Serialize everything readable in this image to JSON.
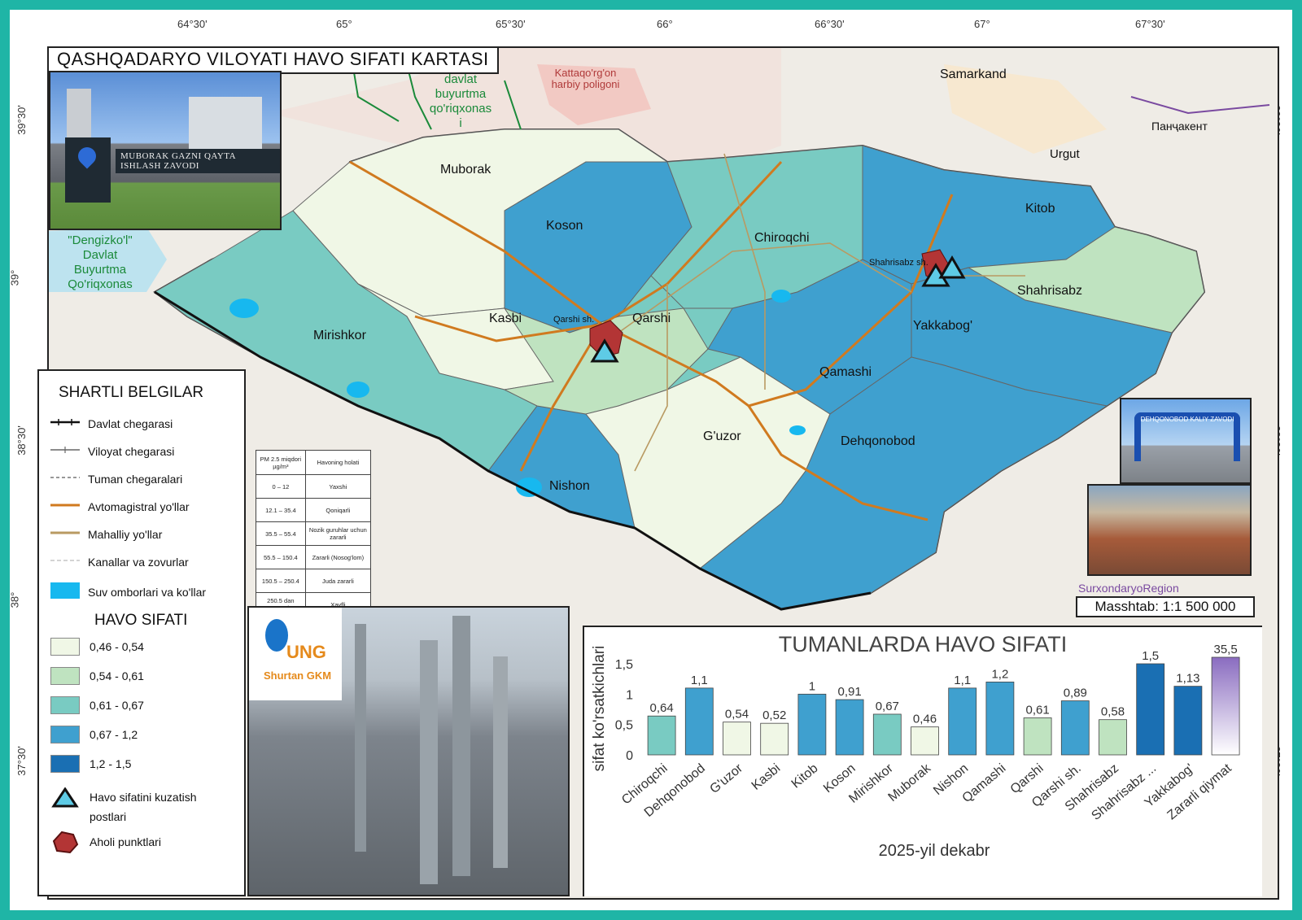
{
  "title": "QASHQADARYO VILOYATI HAVO SIFATI KARTASI",
  "coords": {
    "top_bottom": [
      "64°30'",
      "65°",
      "65°30'",
      "66°",
      "66°30'",
      "67°",
      "67°30'"
    ],
    "sides": [
      "39°30'",
      "39°",
      "38°30'",
      "38°",
      "37°30'"
    ]
  },
  "districts": [
    {
      "name": "Muborak",
      "value_class": "0,46 - 0,54"
    },
    {
      "name": "Koson",
      "value_class": "0,67 - 1,2"
    },
    {
      "name": "Chiroqchi",
      "value_class": "0,61 - 0,67"
    },
    {
      "name": "Kitob",
      "value_class": "0,67 - 1,2"
    },
    {
      "name": "Shahrisabz",
      "value_class": "0,54 - 0,61"
    },
    {
      "name": "Mirishkor",
      "value_class": "0,61 - 0,67"
    },
    {
      "name": "Kasbi",
      "value_class": "0,46 - 0,54"
    },
    {
      "name": "Qarshi",
      "value_class": "0,54 - 0,61"
    },
    {
      "name": "Yakkabog'",
      "value_class": "0,67 - 1,2"
    },
    {
      "name": "Qamashi",
      "value_class": "0,67 - 1,2"
    },
    {
      "name": "G'uzor",
      "value_class": "0,46 - 0,54"
    },
    {
      "name": "Dehqonobod",
      "value_class": "0,67 - 1,2"
    },
    {
      "name": "Nishon",
      "value_class": "0,67 - 1,2"
    }
  ],
  "places": {
    "qarshi_sh": "Qarshi sh.",
    "shahrisabz_sh": "Shahrisabz sh.",
    "samarkand": "Samarkand",
    "urgut": "Urgut",
    "panjakent": "Панҷакент",
    "kattaqorgon": "Kattaqo'rg'on harbiy poligoni",
    "davlat_buyurtma": "davlat buyurtma qo'riqxonas i",
    "dengizkol": "\"Dengizko'l\" Davlat Buyurtma Qo'riqxonas",
    "surxondaryo": "SurxondaryoRegion"
  },
  "scale": "Masshtab: 1:1 500 000",
  "photos": {
    "muborak_caption": "MUBORAK GAZNI QAYTA ISHLASH ZAVODI",
    "dehqonobod_caption": "DEHQONOBOD KALIY ZAVODI",
    "shurtan_logo": "UNG",
    "shurtan_sub": "Shurtan GKM"
  },
  "legend": {
    "title": "SHARTLI BELGILAR",
    "lines": [
      {
        "label": "Davlat chegarasi",
        "style": "state"
      },
      {
        "label": "Viloyat chegarasi",
        "style": "region"
      },
      {
        "label": "Tuman chegaralari",
        "style": "district"
      },
      {
        "label": "Avtomagistral yo'llar",
        "style": "highway"
      },
      {
        "label": "Mahalliy yo'llar",
        "style": "local"
      },
      {
        "label": "Kanallar va zovurlar",
        "style": "canal"
      },
      {
        "label": "Suv omborlari va ko'llar",
        "style": "water"
      }
    ],
    "quality_title": "HAVO SIFATI",
    "classes": [
      {
        "label": "0,46 - 0,54",
        "color": "#f0f7e6"
      },
      {
        "label": "0,54 - 0,61",
        "color": "#bfe3c0"
      },
      {
        "label": "0,61 - 0,67",
        "color": "#79cbc2"
      },
      {
        "label": "0,67 - 1,2",
        "color": "#3fa0cf"
      },
      {
        "label": "1,2 - 1,5",
        "color": "#1a6fb3"
      }
    ],
    "station_label": "Havo sifatini kuzatish postlari",
    "settlement_label": "Aholi punktlari"
  },
  "pm_table": {
    "header": [
      "PM 2.5 miqdori µg/m³",
      "Havoning holati"
    ],
    "rows": [
      [
        "0 – 12",
        "Yaxshi"
      ],
      [
        "12.1 – 35.4",
        "Qoniqarli"
      ],
      [
        "35.5 – 55.4",
        "Nozik guruhlar uchun zararli"
      ],
      [
        "55.5 – 150.4",
        "Zararli (Nosog'lom)"
      ],
      [
        "150.5 – 250.4",
        "Juda zararli"
      ],
      [
        "250.5 dan yuqori",
        "Xavfli"
      ]
    ]
  },
  "chart_data": {
    "type": "bar",
    "title": "TUMANLARDA HAVO SIFATI",
    "xlabel": "2025-yil dekabr",
    "ylabel": "sifat ko'rsatkichlari",
    "ylim": [
      0,
      1.5
    ],
    "yticks": [
      "0",
      "0,5",
      "1",
      "1,5"
    ],
    "categories": [
      "Chiroqchi",
      "Dehqonobod",
      "G'uzor",
      "Kasbi",
      "Kitob",
      "Koson",
      "Mirishkor",
      "Muborak",
      "Nishon",
      "Qamashi",
      "Qarshi",
      "Qarshi sh.",
      "Shahrisabz",
      "Shahrisabz ...",
      "Yakkabog'",
      "Zararli qiymat"
    ],
    "values": [
      0.64,
      1.1,
      0.54,
      0.52,
      1.0,
      0.91,
      0.67,
      0.46,
      1.1,
      1.2,
      0.61,
      0.89,
      0.58,
      1.5,
      1.13,
      35.5
    ],
    "labels": [
      "0,64",
      "1,1",
      "0,54",
      "0,52",
      "1",
      "0,91",
      "0,67",
      "0,46",
      "1,1",
      "1,2",
      "0,61",
      "0,89",
      "0,58",
      "1,5",
      "1,13",
      "35,5"
    ],
    "colors": [
      "#79cbc2",
      "#3fa0cf",
      "#f0f7e6",
      "#f0f7e6",
      "#3fa0cf",
      "#3fa0cf",
      "#79cbc2",
      "#f0f7e6",
      "#3fa0cf",
      "#3fa0cf",
      "#bfe3c0",
      "#3fa0cf",
      "#bfe3c0",
      "#1a6fb3",
      "#1a6fb3",
      "#8a6cc0"
    ],
    "grid": false,
    "legend": "none"
  }
}
